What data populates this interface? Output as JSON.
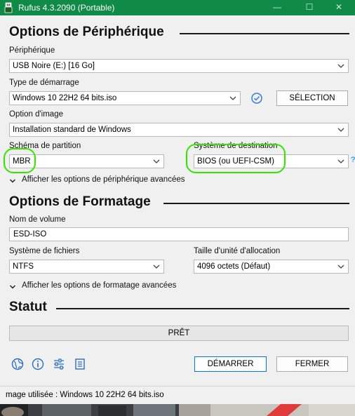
{
  "window": {
    "title": "Rufus 4.3.2090 (Portable)",
    "controls": {
      "minimize": "—",
      "maximize": "☐",
      "close": "✕"
    }
  },
  "device_options": {
    "heading": "Options de Périphérique",
    "device_label": "Périphérique",
    "device_value": "USB Noire (E:) [16 Go]",
    "boot_type_label": "Type de démarrage",
    "boot_type_value": "Windows 10 22H2 64 bits.iso",
    "select_button": "SÉLECTION",
    "image_option_label": "Option d'image",
    "image_option_value": "Installation standard de Windows",
    "partition_scheme_label": "Schéma de partition",
    "partition_scheme_value": "MBR",
    "target_system_label": "Système de destination",
    "target_system_value": "BIOS (ou UEFI-CSM)",
    "help_mark": "?",
    "advanced_toggle": "Afficher les options de périphérique avancées"
  },
  "format_options": {
    "heading": "Options de Formatage",
    "volume_label": "Nom de volume",
    "volume_value": "ESD-ISO",
    "filesystem_label": "Système de fichiers",
    "filesystem_value": "NTFS",
    "cluster_size_label": "Taille d'unité d'allocation",
    "cluster_size_value": "4096 octets (Défaut)",
    "advanced_toggle": "Afficher les options de formatage avancées"
  },
  "status": {
    "heading": "Statut",
    "progress_text": "PRÊT",
    "progress_fraction": 0
  },
  "toolbar": {
    "icons": [
      "globe-icon",
      "info-icon",
      "settings-sliders-icon",
      "log-icon"
    ],
    "start_button": "DÉMARRER",
    "close_button": "FERMER"
  },
  "statusbar": {
    "text": "mage utilisée : Windows 10 22H2 64 bits.iso"
  },
  "colors": {
    "titlebar": "#0f8a47",
    "accent": "#0078d4",
    "highlight": "#33e600"
  }
}
